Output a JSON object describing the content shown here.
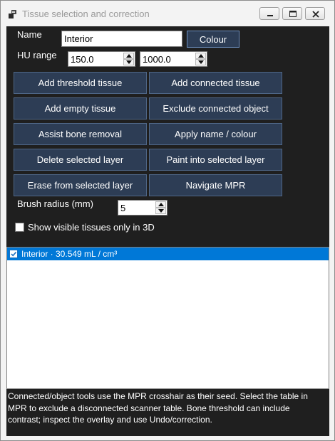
{
  "window": {
    "title": "Tissue selection and correction",
    "controls": [
      "minimize-icon",
      "maximize-icon",
      "close-icon"
    ]
  },
  "form": {
    "name_label": "Name",
    "name_value": "Interior",
    "colour_button": "Colour",
    "hu_label": "HU range",
    "hu_min": "150.0",
    "hu_max": "1000.0",
    "brush_label": "Brush radius (mm)",
    "brush_value": "5",
    "show_visible_label": "Show visible tissues only in 3D",
    "show_visible_checked": false
  },
  "buttons": {
    "add_threshold": "Add threshold tissue",
    "add_connected": "Add connected tissue",
    "add_empty": "Add empty tissue",
    "exclude_connected": "Exclude connected object",
    "assist_bone": "Assist bone removal",
    "apply_name": "Apply name / colour",
    "delete_layer": "Delete selected layer",
    "paint_layer": "Paint into selected layer",
    "erase_layer": "Erase from selected layer",
    "navigate_mpr": "Navigate MPR"
  },
  "tissue_list": {
    "items": [
      {
        "label": "Interior · 30.549 mL / cm³",
        "checked": true,
        "selected": true
      }
    ]
  },
  "status_text": "Connected/object tools use the MPR crosshair as their seed. Select the table in MPR to exclude a disconnected scanner table. Bone threshold can include contrast; inspect the overlay and use Undo/correction.",
  "colors": {
    "panel_background": "#1f1f1f",
    "button_background": "#2d3d55",
    "selection": "#0078d7"
  }
}
